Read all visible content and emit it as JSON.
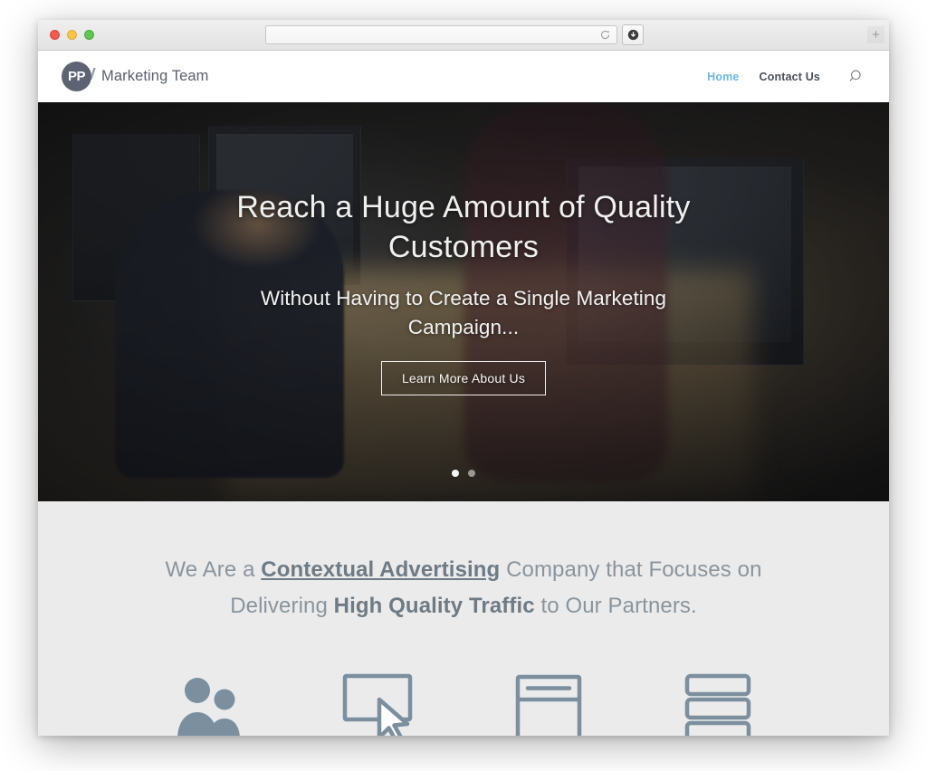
{
  "browser": {
    "traffic_lights": [
      "close",
      "minimize",
      "zoom"
    ],
    "address_value": "",
    "address_placeholder": "",
    "reload_label": "Reload",
    "download_label": "Downloads",
    "newtab_label": "+"
  },
  "site": {
    "logo": {
      "badge": "PP",
      "badge_overlap": "V",
      "text": "Marketing Team"
    },
    "nav": [
      {
        "label": "Home",
        "active": true
      },
      {
        "label": "Contact Us",
        "active": false
      }
    ],
    "search_icon": "search-icon"
  },
  "hero": {
    "title": "Reach a Huge Amount of Quality Customers",
    "subtitle": "Without Having to Create a Single Marketing Campaign...",
    "button_label": "Learn More About Us",
    "slides": 2,
    "active_slide": 1
  },
  "intro": {
    "line1_part1": "We Are a ",
    "line1_strong": "Contextual Advertising",
    "line1_part2": " Company that Focuses on",
    "line2_part1": "Delivering ",
    "line2_strong": "High Quality Traffic",
    "line2_part2": " to Our Partners.",
    "icons": [
      {
        "name": "people-icon"
      },
      {
        "name": "click-screen-icon"
      },
      {
        "name": "browser-window-icon"
      },
      {
        "name": "stacked-bars-icon"
      }
    ]
  },
  "colors": {
    "nav_active": "#6fb7e0",
    "nav_text": "#4a4f58",
    "logo_badge": "#5d6372",
    "intro_bg": "#ebebeb",
    "intro_text": "#8a949c",
    "icon": "#7b8f9e"
  }
}
